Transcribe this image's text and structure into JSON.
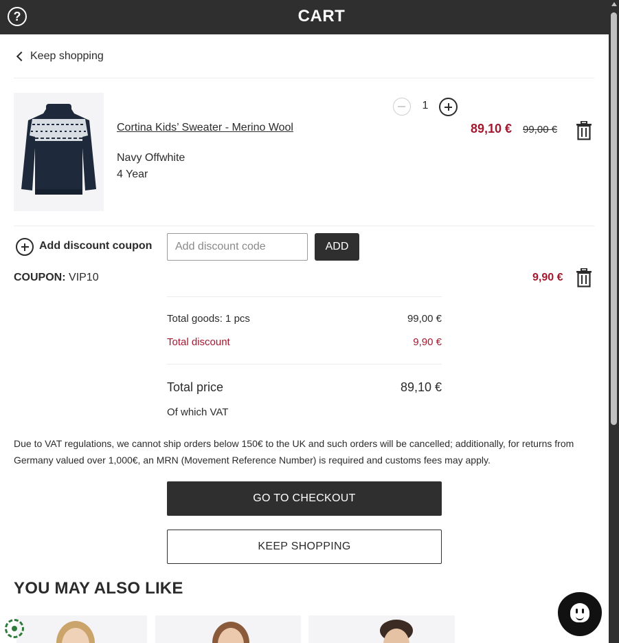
{
  "header": {
    "title": "CART",
    "help_icon": "question-circle-icon",
    "help_glyph": "?"
  },
  "nav": {
    "keep_shopping_label": "Keep shopping"
  },
  "cart_item": {
    "name": "Cortina Kids’ Sweater - Merino Wool",
    "color": "Navy Offwhite",
    "size": "4 Year",
    "quantity": "1",
    "price_now": "89,10 €",
    "price_was": "99,00 €"
  },
  "coupon": {
    "add_label": "Add discount coupon",
    "input_placeholder": "Add discount code",
    "input_value": "",
    "add_button_label": "ADD",
    "applied_label": "COUPON:",
    "applied_code": "VIP10",
    "applied_amount": "9,90 €"
  },
  "summary": {
    "goods_label": "Total goods: 1 pcs",
    "goods_value": "99,00 €",
    "discount_label": "Total discount",
    "discount_value": "9,90 €",
    "total_label": "Total price",
    "total_value": "89,10 €",
    "vat_label": "Of which VAT"
  },
  "notice": {
    "line1": "Due to VAT regulations, we cannot ship orders below 150€ to the UK and such orders will be cancelled; additionally, for returns from",
    "line2": "Germany valued over 1,000€, an MRN (Movement Reference Number) is required and customs fees may apply."
  },
  "actions": {
    "checkout_label": "GO TO CHECKOUT",
    "keep_shopping_label": "KEEP SHOPPING"
  },
  "recommendations": {
    "title": "YOU MAY ALSO LIKE",
    "items": [
      "model-photo-1",
      "model-photo-2",
      "model-photo-3"
    ]
  },
  "colors": {
    "header_bg": "#2f2f2f",
    "price_red": "#a3182f",
    "text": "#2b2b2b"
  }
}
